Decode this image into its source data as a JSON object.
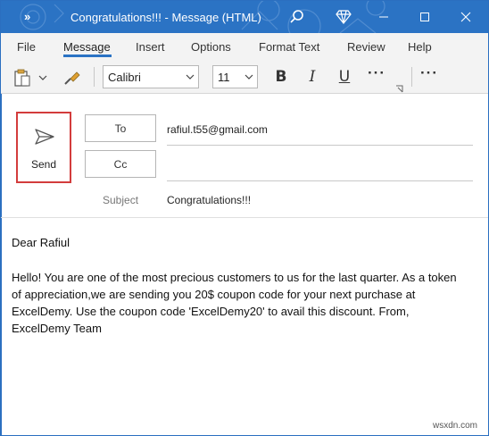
{
  "title_bar": {
    "title": "Congratulations!!! - Message (HTML)",
    "overflow_icon": "double-chevron-right-icon",
    "search_icon": "search-icon",
    "premium_icon": "diamond-icon",
    "window_controls": [
      "minimize-icon",
      "restore-icon",
      "close-icon"
    ],
    "color": "#2b73c4"
  },
  "menu": {
    "items": [
      {
        "label": "File"
      },
      {
        "label": "Message",
        "active": true
      },
      {
        "label": "Insert"
      },
      {
        "label": "Options"
      },
      {
        "label": "Format Text"
      },
      {
        "label": "Review"
      },
      {
        "label": "Help"
      }
    ]
  },
  "ribbon": {
    "font_name": "Calibri",
    "font_size": "11",
    "bold_label": "B",
    "italic_label": "I",
    "underline_label": "U",
    "more_label": "···"
  },
  "header": {
    "send_label": "Send",
    "to_label": "To",
    "cc_label": "Cc",
    "subject_label": "Subject",
    "to_value": "rafiul.t55@gmail.com",
    "cc_value": "",
    "subject_value": "Congratulations!!!"
  },
  "message": {
    "greeting": "Dear Rafiul",
    "body": "Hello! You are one of the most precious customers to us for the last quarter. As a token of appreciation,we are sending you 20$ coupon code for your next purchase at ExcelDemy. Use the coupon code 'ExcelDemy20' to avail this discount. From, ExcelDemy Team"
  },
  "watermark": "wsxdn.com",
  "accent_colors": {
    "send_highlight": "#d33c3c",
    "active_tab": "#2b73c4"
  }
}
